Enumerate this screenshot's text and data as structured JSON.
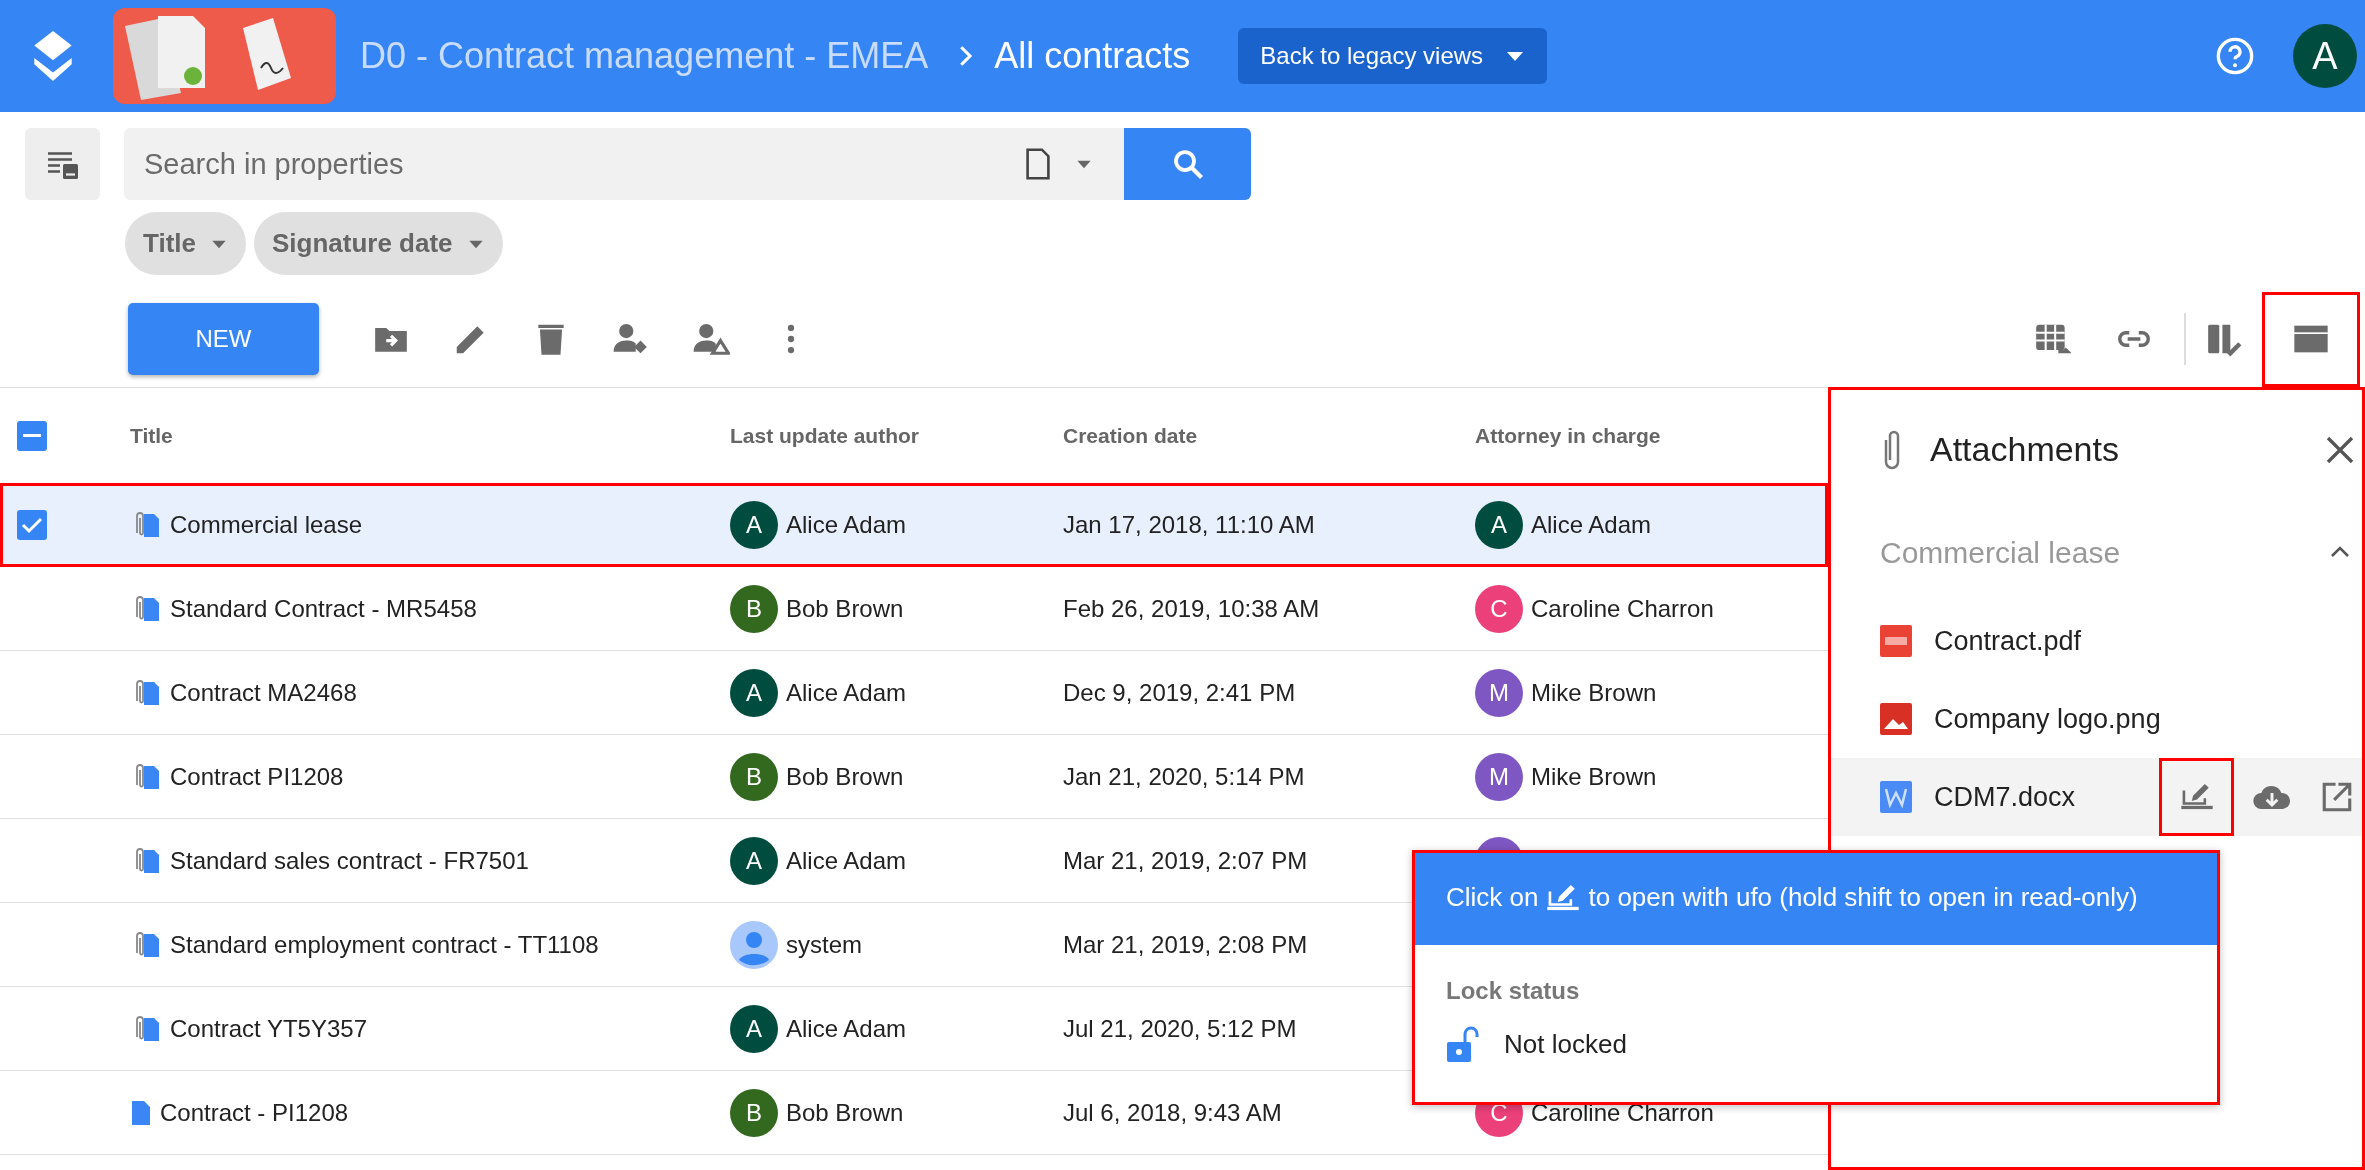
{
  "header": {
    "app_title": "D0 - Contract management - EMEA",
    "breadcrumb": "All contracts",
    "legacy_button": "Back to legacy views",
    "user_initial": "A"
  },
  "search": {
    "placeholder": "Search in properties",
    "filters": [
      "Title",
      "Signature date"
    ]
  },
  "toolbar": {
    "new_button": "NEW",
    "panel_toggle_highlighted": true
  },
  "table": {
    "indeterminate": true,
    "columns": [
      "Title",
      "Last update author",
      "Creation date",
      "Attorney in charge"
    ],
    "rows": [
      {
        "title": "Commercial lease",
        "has_attachments": true,
        "selected": true,
        "highlighted": true,
        "author": {
          "kind": "initial",
          "initial": "A",
          "name": "Alice Adam",
          "color": "#004d40"
        },
        "created": "Jan 17, 2018, 11:10 AM",
        "attorney": {
          "kind": "initial",
          "initial": "A",
          "name": "Alice Adam",
          "color": "#004d40"
        }
      },
      {
        "title": "Standard Contract - MR5458",
        "has_attachments": true,
        "selected": false,
        "highlighted": false,
        "author": {
          "kind": "initial",
          "initial": "B",
          "name": "Bob Brown",
          "color": "#33691e"
        },
        "created": "Feb 26, 2019, 10:38 AM",
        "attorney": {
          "kind": "initial",
          "initial": "C",
          "name": "Caroline Charron",
          "color": "#ec407a"
        }
      },
      {
        "title": "Contract MA2468",
        "has_attachments": true,
        "selected": false,
        "highlighted": false,
        "author": {
          "kind": "initial",
          "initial": "A",
          "name": "Alice Adam",
          "color": "#004d40"
        },
        "created": "Dec 9, 2019, 2:41 PM",
        "attorney": {
          "kind": "initial",
          "initial": "M",
          "name": "Mike Brown",
          "color": "#7e57c2"
        }
      },
      {
        "title": "Contract PI1208",
        "has_attachments": true,
        "selected": false,
        "highlighted": false,
        "author": {
          "kind": "initial",
          "initial": "B",
          "name": "Bob Brown",
          "color": "#33691e"
        },
        "created": "Jan 21, 2020, 5:14 PM",
        "attorney": {
          "kind": "initial",
          "initial": "M",
          "name": "Mike Brown",
          "color": "#7e57c2"
        }
      },
      {
        "title": "Standard sales contract - FR7501",
        "has_attachments": true,
        "selected": false,
        "highlighted": false,
        "author": {
          "kind": "initial",
          "initial": "A",
          "name": "Alice Adam",
          "color": "#004d40"
        },
        "created": "Mar 21, 2019, 2:07 PM",
        "attorney": {
          "kind": "covered",
          "color": "#7e57c2"
        }
      },
      {
        "title": "Standard employment contract - TT1108",
        "has_attachments": true,
        "selected": false,
        "highlighted": false,
        "author": {
          "kind": "person",
          "name": "system"
        },
        "created": "Mar 21, 2019, 2:08 PM"
      },
      {
        "title": "Contract YT5Y357",
        "has_attachments": true,
        "selected": false,
        "highlighted": false,
        "author": {
          "kind": "initial",
          "initial": "A",
          "name": "Alice Adam",
          "color": "#004d40"
        },
        "created": "Jul 21, 2020, 5:12 PM"
      },
      {
        "title": "Contract - PI1208",
        "has_attachments": false,
        "selected": false,
        "highlighted": false,
        "author": {
          "kind": "initial",
          "initial": "B",
          "name": "Bob Brown",
          "color": "#33691e"
        },
        "created": "Jul 6, 2018, 9:43 AM",
        "attorney": {
          "kind": "initial",
          "initial": "C",
          "name": "Caroline Charron",
          "color": "#ec407a"
        }
      }
    ]
  },
  "panel": {
    "title": "Attachments",
    "document": "Commercial lease",
    "expanded": true,
    "highlighted": true,
    "attachments": [
      {
        "name": "Contract.pdf",
        "kind": "pdf",
        "hovered": false
      },
      {
        "name": "Company logo.png",
        "kind": "image",
        "hovered": false
      },
      {
        "name": "CDM7.docx",
        "kind": "word",
        "hovered": true,
        "edit_highlighted": true
      }
    ]
  },
  "tooltip": {
    "before_icon": "Click on",
    "after_icon": "to open with ufo (hold shift to open in read-only)",
    "lock_label": "Lock status",
    "locked": false,
    "lock_status": "Not locked",
    "highlighted": true
  }
}
